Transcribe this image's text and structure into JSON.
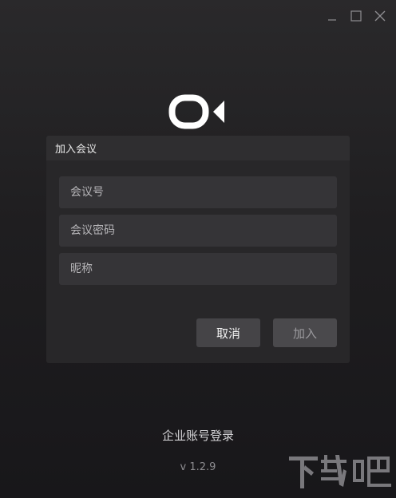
{
  "window_controls": {
    "minimize": "minimize-icon",
    "maximize": "maximize-icon",
    "close": "close-icon"
  },
  "logo": "video-camera-icon",
  "dialog": {
    "title": "加入会议",
    "fields": {
      "meeting_id": {
        "placeholder": "会议号",
        "value": ""
      },
      "meeting_password": {
        "placeholder": "会议密码",
        "value": ""
      },
      "nickname": {
        "placeholder": "昵称",
        "value": ""
      }
    },
    "cancel_label": "取消",
    "join_label": "加入"
  },
  "footer": {
    "enterprise_login": "企业账号登录",
    "version": "v 1.2.9"
  },
  "watermark": {
    "text": "下载吧",
    "url": "www.xiazaiba.com"
  },
  "colors": {
    "background": "#1f1e20",
    "dialog": "#282729",
    "field": "#353437",
    "button_cancel": "#454447",
    "button_join_disabled": "#4a494c"
  }
}
